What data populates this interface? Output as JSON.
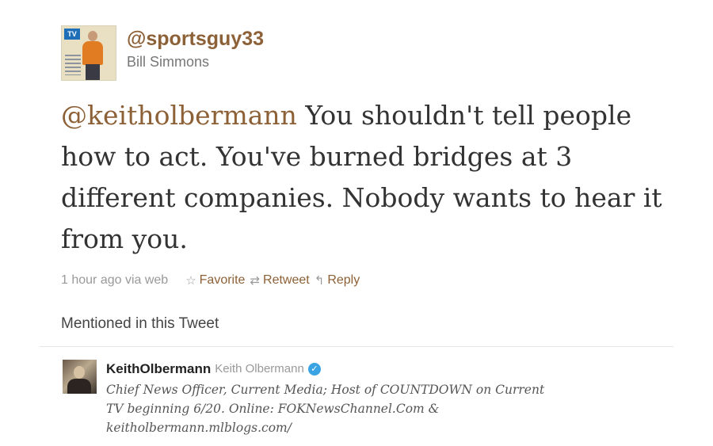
{
  "author": {
    "screen_name": "@sportsguy33",
    "full_name": "Bill Simmons",
    "avatar_badge": "TV"
  },
  "tweet": {
    "mention": "@keitholbermann",
    "text": " You shouldn't tell people how to act. You've burned bridges at 3 different companies. Nobody wants to hear it from you."
  },
  "meta": {
    "timestamp": "1 hour ago via web",
    "favorite_label": "Favorite",
    "retweet_label": "Retweet",
    "reply_label": "Reply",
    "favorite_icon": "☆",
    "retweet_icon": "⇄",
    "reply_icon": "↰"
  },
  "mentioned": {
    "heading": "Mentioned in this Tweet",
    "user": {
      "screen_name": "KeithOlbermann",
      "full_name": "Keith Olbermann",
      "verified_icon": "✓",
      "bio": "Chief News Officer, Current Media; Host of COUNTDOWN on Current TV beginning 6/20. Online: FOKNewsChannel.Com & keitholbermann.mlblogs.com/"
    }
  },
  "colors": {
    "link": "#8d6137",
    "muted": "#999999",
    "text": "#333333",
    "verified": "#3aa3e3"
  }
}
